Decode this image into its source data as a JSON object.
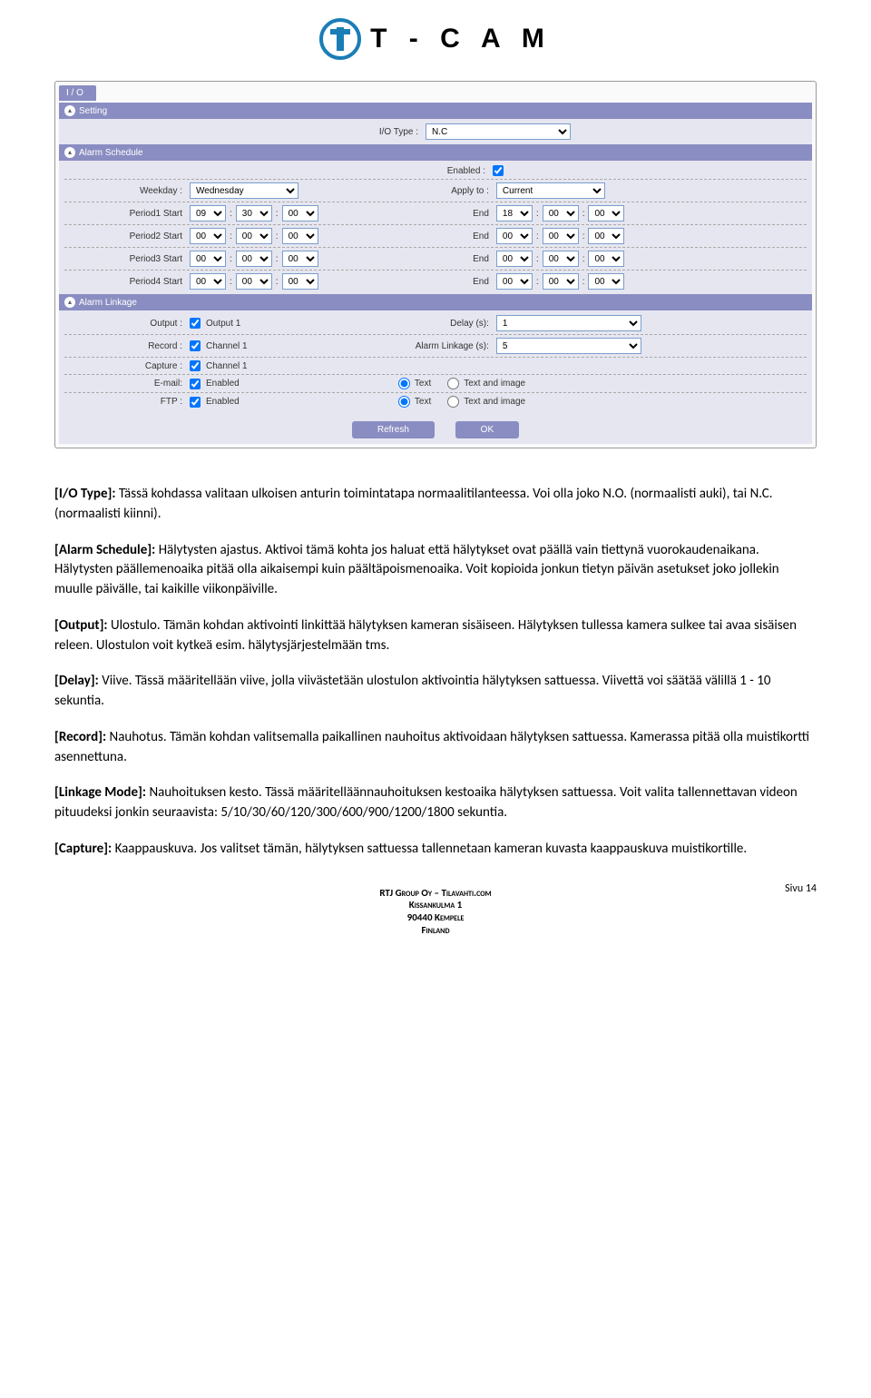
{
  "brand": "T - C A M",
  "panel": {
    "tab": "I / O",
    "sections": {
      "setting": {
        "title": "Setting",
        "io_type_label": "I/O Type :",
        "io_type_value": "N.C"
      },
      "schedule": {
        "title": "Alarm Schedule",
        "enabled_label": "Enabled :",
        "weekday_label": "Weekday :",
        "weekday_value": "Wednesday",
        "apply_label": "Apply to :",
        "apply_value": "Current",
        "periods": [
          {
            "start_label": "Period1 Start",
            "start": [
              "09",
              "30",
              "00"
            ],
            "end_label": "End",
            "end": [
              "18",
              "00",
              "00"
            ]
          },
          {
            "start_label": "Period2 Start",
            "start": [
              "00",
              "00",
              "00"
            ],
            "end_label": "End",
            "end": [
              "00",
              "00",
              "00"
            ]
          },
          {
            "start_label": "Period3 Start",
            "start": [
              "00",
              "00",
              "00"
            ],
            "end_label": "End",
            "end": [
              "00",
              "00",
              "00"
            ]
          },
          {
            "start_label": "Period4 Start",
            "start": [
              "00",
              "00",
              "00"
            ],
            "end_label": "End",
            "end": [
              "00",
              "00",
              "00"
            ]
          }
        ]
      },
      "linkage": {
        "title": "Alarm Linkage",
        "output_label": "Output :",
        "output_chk": "Output 1",
        "delay_label": "Delay (s):",
        "delay_value": "1",
        "record_label": "Record :",
        "record_chk": "Channel 1",
        "linkage_label": "Alarm Linkage (s):",
        "linkage_value": "5",
        "capture_label": "Capture :",
        "capture_chk": "Channel 1",
        "email_label": "E-mail:",
        "email_chk": "Enabled",
        "ftp_label": "FTP :",
        "ftp_chk": "Enabled",
        "radio_text": "Text",
        "radio_textimg": "Text and image"
      }
    },
    "refresh": "Refresh",
    "ok": "OK"
  },
  "doc": {
    "p1a": "[I/O Type]:",
    "p1b": " Tässä kohdassa valitaan ulkoisen anturin toimintatapa normaalitilanteessa. Voi olla joko N.O. (normaalisti auki), tai N.C. (normaalisti kiinni).",
    "p2a": "[Alarm Schedule]:",
    "p2b": " Hälytysten ajastus. Aktivoi tämä kohta jos haluat että hälytykset ovat päällä vain tiettynä vuorokaudenaikana. Hälytysten päällemenoaika pitää olla aikaisempi kuin päältäpoismenoaika. Voit kopioida jonkun tietyn päivän asetukset joko jollekin muulle päivälle, tai kaikille viikonpäiville.",
    "p3a": "[Output]:",
    "p3b": " Ulostulo. Tämän kohdan aktivointi linkittää hälytyksen kameran sisäiseen. Hälytyksen tullessa kamera sulkee tai avaa sisäisen releen. Ulostulon voit kytkeä esim. hälytysjärjestelmään tms.",
    "p4a": "[Delay]:",
    "p4b": " Viive. Tässä määritellään viive, jolla viivästetään ulostulon aktivointia hälytyksen sattuessa. Viivettä voi säätää välillä 1 - 10 sekuntia.",
    "p5a": "[Record]:",
    "p5b": " Nauhotus. Tämän kohdan valitsemalla paikallinen nauhoitus aktivoidaan hälytyksen sattuessa. Kamerassa pitää olla muistikortti asennettuna.",
    "p6a": "[Linkage Mode]:",
    "p6b": " Nauhoituksen kesto. Tässä määritelläännauhoituksen kestoaika hälytyksen sattuessa. Voit valita tallennettavan videon pituudeksi jonkin seuraavista: 5/10/30/60/120/300/600/900/1200/1800 sekuntia.",
    "p7a": "[Capture]:",
    "p7b": " Kaappauskuva. Jos valitset tämän, hälytyksen sattuessa tallennetaan kameran kuvasta kaappauskuva muistikortille."
  },
  "footer": {
    "l1": "RTJ Group Oy – Tilavahti.com",
    "l2": "Kissankulma 1",
    "l3": "90440 Kempele",
    "l4": "Finland",
    "page": "Sivu 14"
  }
}
